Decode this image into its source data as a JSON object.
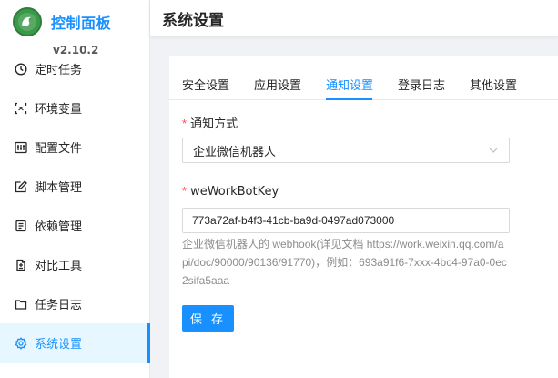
{
  "brand": {
    "title": "控制面板",
    "version": "v2.10.2",
    "logo_icon": "dragon-logo-icon",
    "title_color": "#1890ff"
  },
  "sidebar": {
    "items": [
      {
        "label": "定时任务",
        "icon": "clock-icon"
      },
      {
        "label": "环境变量",
        "icon": "variable-icon"
      },
      {
        "label": "配置文件",
        "icon": "control-icon"
      },
      {
        "label": "脚本管理",
        "icon": "edit-icon"
      },
      {
        "label": "依赖管理",
        "icon": "package-icon"
      },
      {
        "label": "对比工具",
        "icon": "diff-icon"
      },
      {
        "label": "任务日志",
        "icon": "folder-icon"
      },
      {
        "label": "系统设置",
        "icon": "gear-icon",
        "active": true
      }
    ]
  },
  "header": {
    "title": "系统设置"
  },
  "tabs": [
    {
      "label": "安全设置"
    },
    {
      "label": "应用设置"
    },
    {
      "label": "通知设置",
      "active": true
    },
    {
      "label": "登录日志"
    },
    {
      "label": "其他设置"
    }
  ],
  "form": {
    "notify_mode": {
      "label": "通知方式",
      "value": "企业微信机器人"
    },
    "bot_key": {
      "label": "weWorkBotKey",
      "value": "773a72af-b4f3-41cb-ba9d-0497ad073000",
      "help": "企业微信机器人的 webhook(详见文档 https://work.weixin.qq.com/api/doc/90000/90136/91770)，例如：693a91f6-7xxx-4bc4-97a0-0ec2sifa5aaa"
    },
    "save_label": "保 存"
  },
  "colors": {
    "primary": "#1890ff",
    "required": "#ff4d4f",
    "active_bg": "#e6f7ff"
  }
}
